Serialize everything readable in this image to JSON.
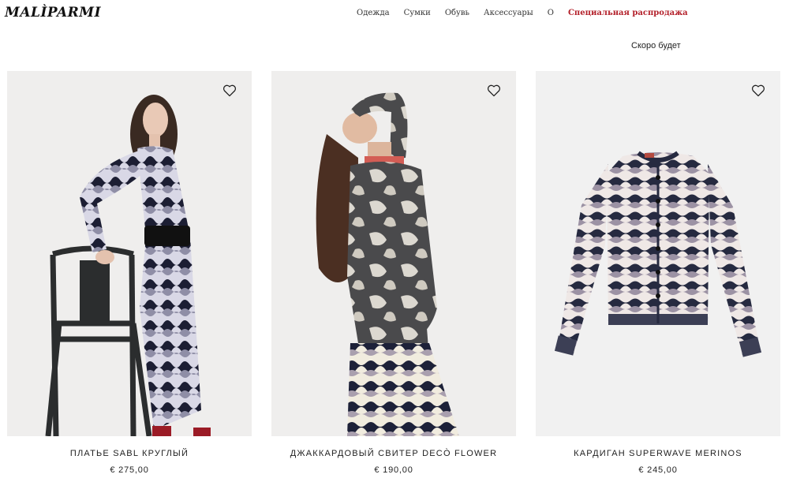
{
  "brand": {
    "logo_text": "MALÌPARMI"
  },
  "nav": {
    "items": [
      "Одежда",
      "Сумки",
      "Обувь",
      "Аксессуары",
      "О"
    ],
    "sale": "Специальная распродажа"
  },
  "coming_soon": "Скоро будет",
  "colors": {
    "sale": "#b3202a",
    "photo_bg": "#efeeed"
  },
  "products": [
    {
      "name": "ПЛАТЬЕ SABL КРУГЛЫЙ",
      "price": "€ 275,00",
      "icon": "heart-icon"
    },
    {
      "name": "ДЖАККАРДОВЫЙ СВИТЕР DECÒ FLOWER",
      "price": "€ 190,00",
      "icon": "heart-icon"
    },
    {
      "name": "КАРДИГАН SUPERWAVE MERINOS",
      "price": "€ 245,00",
      "icon": "heart-icon"
    }
  ]
}
